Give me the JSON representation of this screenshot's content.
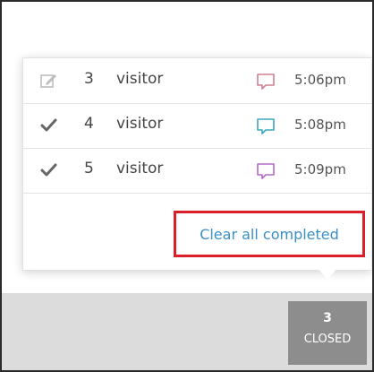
{
  "rows": [
    {
      "status_icon": "edit-icon",
      "number": "3",
      "name": "visitor",
      "chat_color": "#d08090",
      "time": "5:06pm"
    },
    {
      "status_icon": "check-icon",
      "number": "4",
      "name": "visitor",
      "chat_color": "#3aa7bf",
      "time": "5:08pm"
    },
    {
      "status_icon": "check-icon",
      "number": "5",
      "name": "visitor",
      "chat_color": "#b46bc9",
      "time": "5:09pm"
    }
  ],
  "clear_link": {
    "label": "Clear all completed"
  },
  "closed_tab": {
    "count": "3",
    "label": "CLOSED"
  }
}
